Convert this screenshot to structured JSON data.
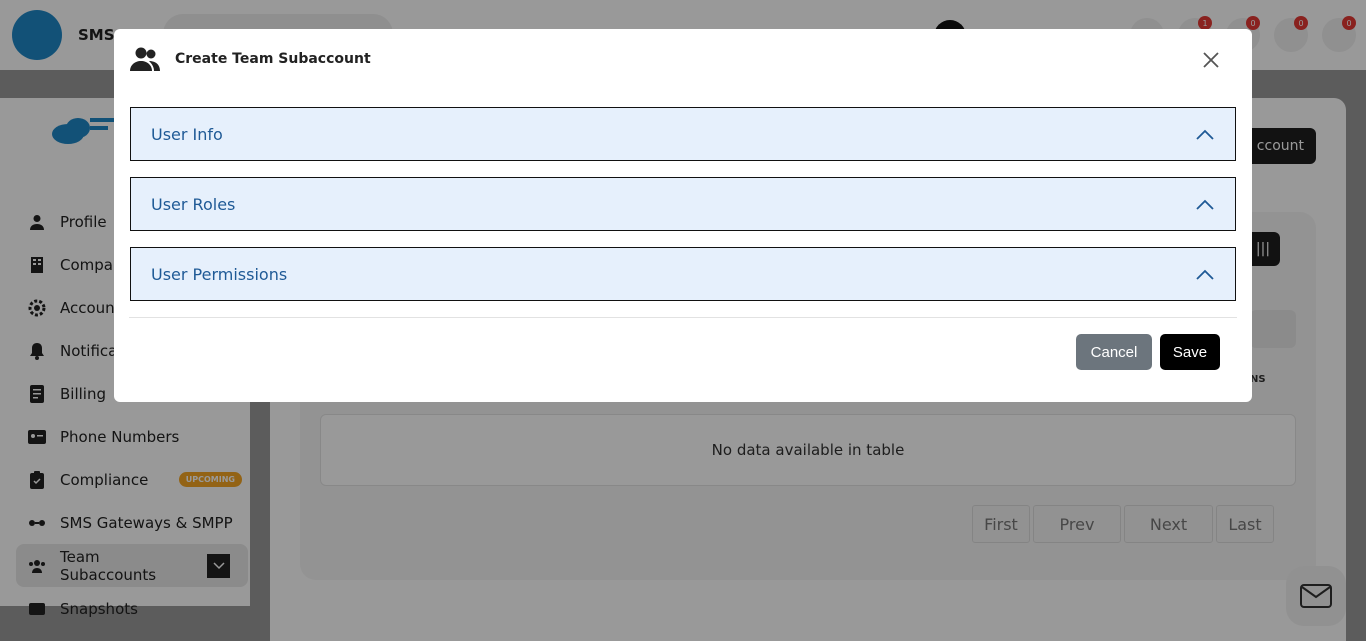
{
  "app": {
    "name": "SMS-"
  },
  "topbar": {
    "badges": [
      "1",
      "0",
      "0",
      "0"
    ]
  },
  "sidebar": {
    "items": [
      {
        "label": "Profile",
        "icon": "user-icon"
      },
      {
        "label": "Compar",
        "icon": "building-icon"
      },
      {
        "label": "Accoun",
        "icon": "gear-icon"
      },
      {
        "label": "Notificat",
        "icon": "bell-icon"
      },
      {
        "label": "Billing",
        "icon": "receipt-icon"
      },
      {
        "label": "Phone Numbers",
        "icon": "id-card-icon"
      },
      {
        "label": "Compliance",
        "icon": "clipboard-icon",
        "tag": "UPCOMING"
      },
      {
        "label": "SMS Gateways & SMPP",
        "icon": "gateway-icon"
      },
      {
        "label": "Team Subaccounts",
        "icon": "users-icon",
        "active": true
      },
      {
        "label": "Snapshots",
        "icon": "snapshot-icon"
      }
    ]
  },
  "main": {
    "add_button_label": "ccount",
    "column_fragment": "NS",
    "empty_table_text": "No data available in table",
    "pagination": {
      "first": "First",
      "prev": "Prev",
      "next": "Next",
      "last": "Last"
    }
  },
  "modal": {
    "title": "Create Team Subaccount",
    "sections": [
      {
        "label": "User Info"
      },
      {
        "label": "User Roles"
      },
      {
        "label": "User Permissions"
      }
    ],
    "cancel_label": "Cancel",
    "save_label": "Save"
  },
  "colors": {
    "accordion_bg": "#e6f0fc",
    "accordion_text": "#1f5a96",
    "cancel_bg": "#6c757d",
    "save_bg": "#000000",
    "brand_blue": "#1e88c7",
    "upcoming_tag": "#f5a623"
  }
}
